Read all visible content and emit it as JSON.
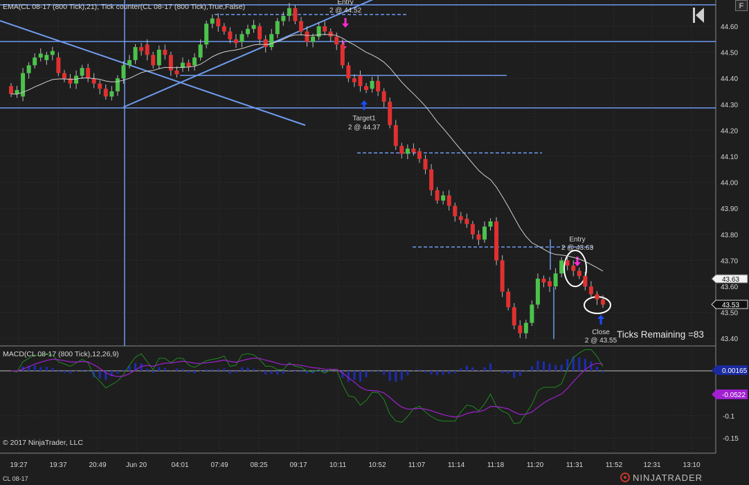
{
  "window": {
    "instrument_tab": "CL 08-17",
    "brand": "NINJATRADER",
    "f_button": "F"
  },
  "colors": {
    "background": "#1e1e1e",
    "grid": "#3a3a3a",
    "up_candle": "#4cc24c",
    "down_candle": "#e03030",
    "wick": "#bcbcbc",
    "ema": "#d0d0d0",
    "drawing_line": "#6f9cf0",
    "entry_arrow": "#ff2bd6",
    "target_arrow": "#1a4dff",
    "macd": "#1f8a1f",
    "signal": "#a020d0",
    "histogram": "#1c2db5"
  },
  "chart_data": [
    {
      "panel": "price",
      "type": "candlestick",
      "title": "EMA(CL 08-17 (800 Tick),21), Tick counter(CL 08-17 (800 Tick),True,False)",
      "ylim": [
        43.37,
        44.68
      ],
      "yticks": [
        "44.60",
        "44.50",
        "44.40",
        "44.30",
        "44.20",
        "44.10",
        "44.00",
        "43.90",
        "43.80",
        "43.70",
        "43.60",
        "43.50",
        "43.40"
      ],
      "xticks": [
        "19:27",
        "19:37",
        "20:49",
        "Jun 20",
        "04:01",
        "07:49",
        "08:25",
        "09:17",
        "10:11",
        "10:52",
        "11:07",
        "11:14",
        "11:18",
        "11:20",
        "11:31",
        "11:52",
        "12:31",
        "13:10"
      ],
      "price_markers": [
        "43.63",
        "43.53"
      ],
      "close": [
        44.34,
        44.33,
        44.42,
        44.45,
        44.48,
        44.47,
        44.49,
        44.48,
        44.42,
        44.4,
        44.38,
        44.41,
        44.44,
        44.4,
        44.38,
        44.36,
        44.33,
        44.35,
        44.4,
        44.45,
        44.47,
        44.52,
        44.53,
        44.49,
        44.45,
        44.51,
        44.49,
        44.43,
        44.44,
        44.46,
        44.45,
        44.48,
        44.53,
        44.61,
        44.63,
        44.6,
        44.58,
        44.55,
        44.54,
        44.57,
        44.59,
        44.6,
        44.55,
        44.52,
        44.57,
        44.62,
        44.64,
        44.67,
        44.62,
        44.58,
        44.54,
        44.56,
        44.6,
        44.58,
        44.56,
        44.53,
        44.45,
        44.4,
        44.41,
        44.37,
        44.36,
        44.39,
        44.35,
        44.31,
        44.22,
        44.14,
        44.11,
        44.13,
        44.12,
        44.09,
        44.05,
        43.97,
        43.93,
        43.95,
        43.91,
        43.87,
        43.86,
        43.84,
        43.8,
        43.78,
        43.83,
        43.85,
        43.7,
        43.58,
        43.52,
        43.45,
        43.42,
        43.46,
        43.53,
        43.63,
        43.62,
        43.6,
        43.65,
        43.7,
        43.68,
        43.66,
        43.64,
        43.6,
        43.57,
        43.55,
        43.53
      ]
    },
    {
      "panel": "macd",
      "type": "line",
      "title": "MACD(CL 08-17 (800 Tick),12,26,9)",
      "series": [
        {
          "name": "MACD"
        },
        {
          "name": "Avg"
        },
        {
          "name": "Diff"
        }
      ],
      "yticks": [
        "-0.1",
        "-0.15"
      ],
      "value_markers": [
        "0.00165",
        "-0.0522"
      ]
    }
  ],
  "annotations": {
    "entry1": {
      "title": "Entry",
      "detail": "2 @ 44.52"
    },
    "target1": {
      "title": "Target1",
      "detail": "2 @ 44.37"
    },
    "entry2": {
      "title": "Entry",
      "detail": "2 @ 43.63"
    },
    "close": {
      "title": "Close",
      "detail": "2 @ 43.55"
    },
    "ticks_remaining": "Ticks Remaining =83",
    "copyright": "© 2017 NinjaTrader, LLC"
  }
}
